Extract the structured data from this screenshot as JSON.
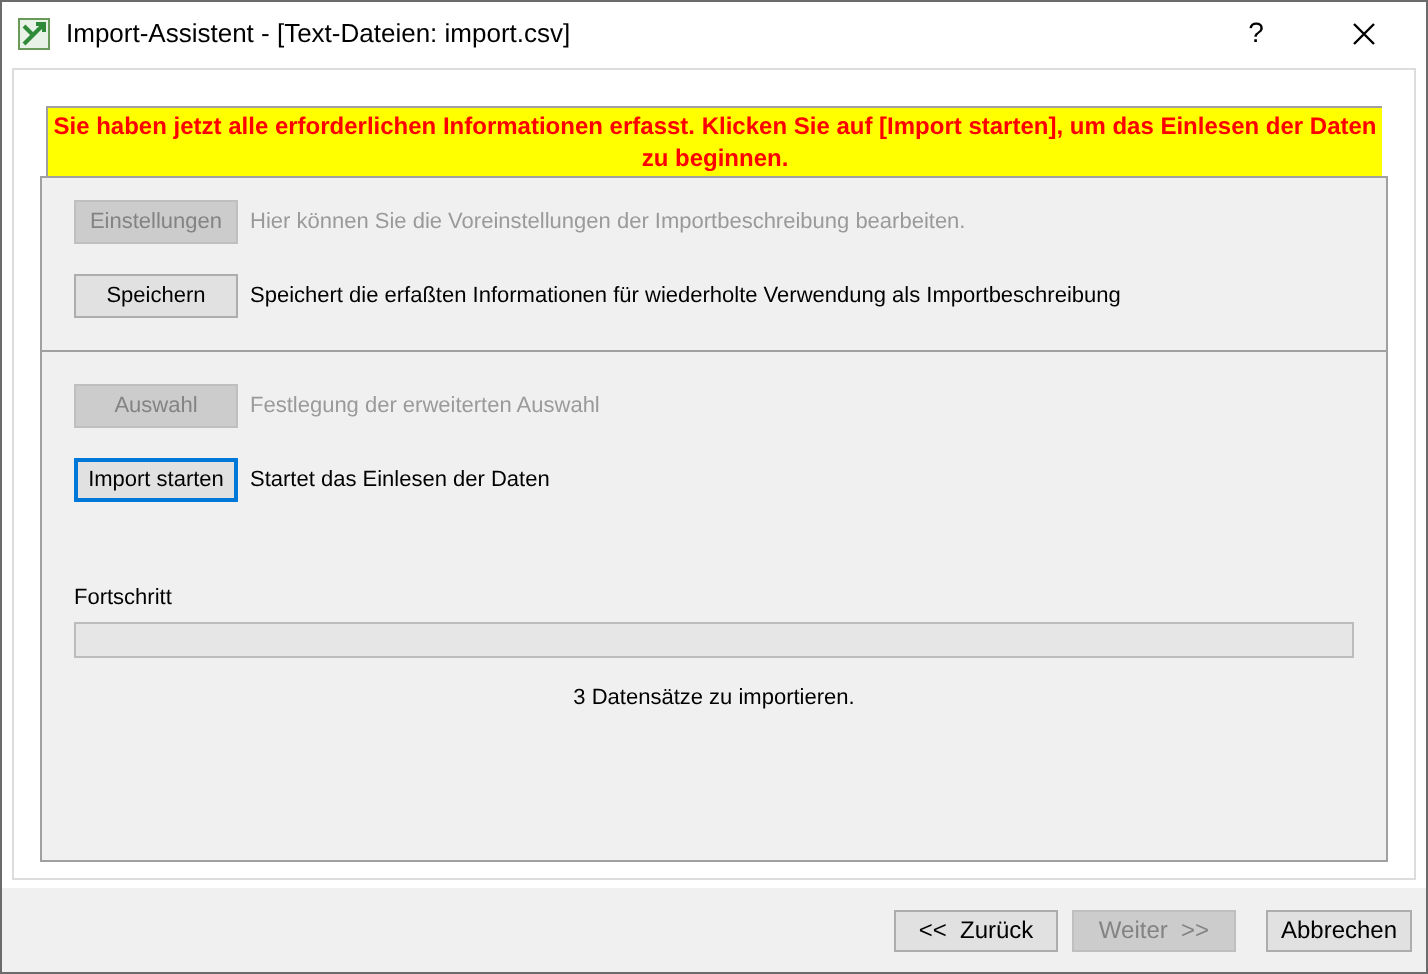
{
  "window": {
    "title": "Import-Assistent - [Text-Dateien: import.csv]",
    "help": "?"
  },
  "banner": "Sie haben jetzt alle erforderlichen Informationen erfasst. Klicken Sie auf [Import starten], um das Einlesen der Daten zu beginnen.",
  "sections": [
    {
      "rows": [
        {
          "button": "Einstellungen",
          "description": "Hier können Sie die Voreinstellungen der Importbeschreibung bearbeiten.",
          "disabled": true,
          "focused": false
        },
        {
          "button": "Speichern",
          "description": "Speichert die erfaßten Informationen für wiederholte Verwendung als Importbeschreibung",
          "disabled": false,
          "focused": false
        }
      ]
    },
    {
      "rows": [
        {
          "button": "Auswahl",
          "description": "Festlegung der erweiterten Auswahl",
          "disabled": true,
          "focused": false
        },
        {
          "button": "Import starten",
          "description": "Startet das Einlesen der Daten",
          "disabled": false,
          "focused": true
        }
      ]
    }
  ],
  "progress": {
    "label": "Fortschritt",
    "level": 0,
    "status": "3 Datensätze zu importieren."
  },
  "footer_buttons": [
    {
      "label": "<<  Zurück",
      "disabled": false
    },
    {
      "label": "Weiter  >>",
      "disabled": true
    },
    {
      "label": "Abbrechen",
      "disabled": false
    }
  ]
}
